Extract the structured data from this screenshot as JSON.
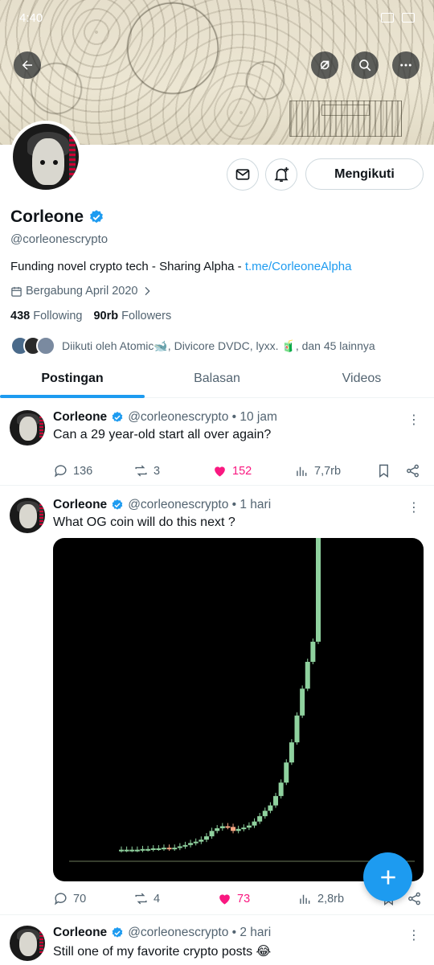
{
  "status_bar": {
    "time": "4:40"
  },
  "profile": {
    "name": "Corleone",
    "handle": "@corleonescrypto",
    "bio_text": "Funding novel crypto tech - Sharing Alpha - ",
    "bio_link": "t.me/CorleoneAlpha",
    "joined": "Bergabung April 2020",
    "following_count": "438",
    "following_label": "Following",
    "followers_count": "90rb",
    "followers_label": "Followers",
    "followed_by": "Diikuti oleh Atomic🐋, Divicore DVDC, lyxx. 🧃, dan 45 lainnya",
    "follow_button": "Mengikuti",
    "accent_color": "#1d9bf0"
  },
  "tabs": [
    {
      "label": "Postingan",
      "active": true
    },
    {
      "label": "Balasan",
      "active": false
    },
    {
      "label": "Videos",
      "active": false
    }
  ],
  "posts": [
    {
      "name": "Corleone",
      "meta": "@corleonescrypto • 10 jam",
      "text": "Can a 29 year-old start all over again?",
      "replies": "136",
      "reposts": "3",
      "likes": "152",
      "views": "7,7rb",
      "liked": true
    },
    {
      "name": "Corleone",
      "meta": "@corleonescrypto • 1 hari",
      "text": "What OG coin will do this next ?",
      "replies": "70",
      "reposts": "4",
      "likes": "73",
      "views": "2,8rb",
      "liked": true
    },
    {
      "name": "Corleone",
      "meta": "@corleonescrypto • 2 hari",
      "text": "Still one of my favorite crypto posts 😂"
    }
  ],
  "chart_data": {
    "type": "candlestick",
    "title": "",
    "values": [
      1,
      1,
      1,
      1,
      1.1,
      1.1,
      1.2,
      1.2,
      1.3,
      1.2,
      1.3,
      1.5,
      1.7,
      2,
      2.2,
      2.5,
      3,
      3.8,
      4.2,
      4.5,
      4.4,
      3.8,
      4.1,
      4.3,
      4.6,
      5.2,
      6,
      6.8,
      7.6,
      9,
      11,
      14,
      17,
      21,
      25,
      29,
      32,
      55
    ],
    "colors": {
      "up": "#8fd19e",
      "down": "#f4a582",
      "background": "#000000"
    }
  }
}
